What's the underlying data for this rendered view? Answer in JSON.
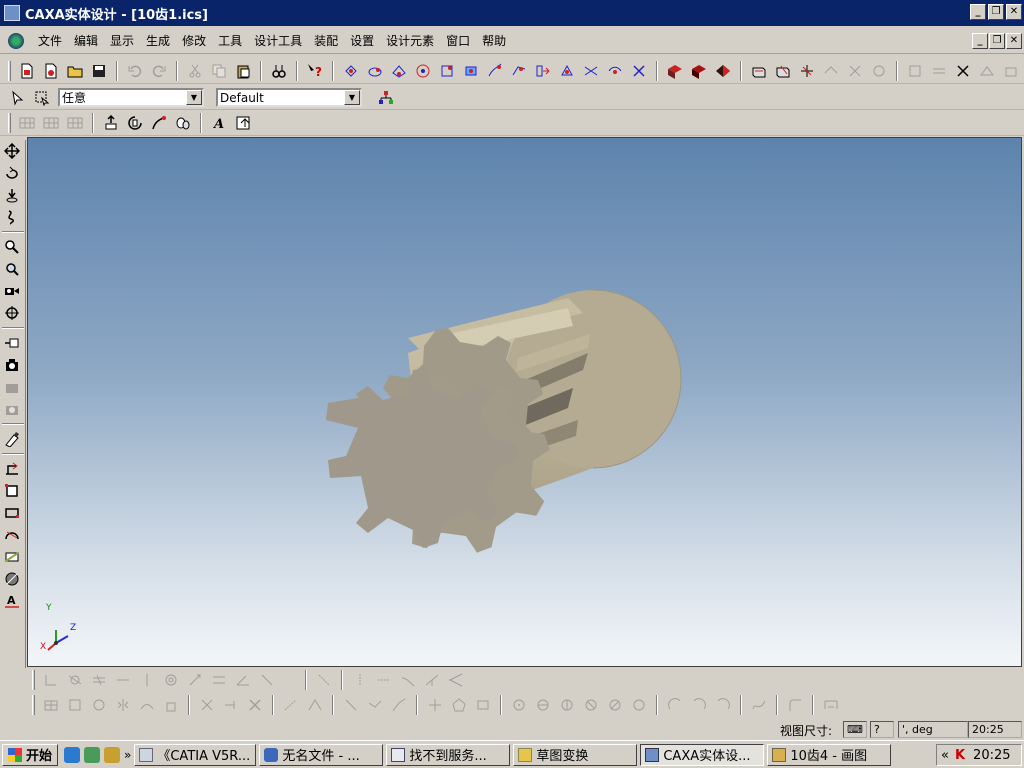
{
  "window": {
    "title": "CAXA实体设计 - [10齿1.ics]",
    "minimize_label": "_",
    "restore_label": "❐",
    "close_label": "✕"
  },
  "menu": {
    "items": [
      "文件",
      "编辑",
      "显示",
      "生成",
      "修改",
      "工具",
      "设计工具",
      "装配",
      "设置",
      "设计元素",
      "窗口",
      "帮助"
    ]
  },
  "toolbar2": {
    "filter_value": "任意",
    "style_value": "Default"
  },
  "viewport": {
    "triad": {
      "y_label": "Y",
      "x_label": "X",
      "z_label": "Z"
    },
    "colors": {
      "gear": "#a29a89",
      "body": "#bdb399",
      "bg_top": "#5d83ad",
      "bg_bottom": "#f3f6f9"
    }
  },
  "status": {
    "view_size_label": "视图尺寸:",
    "units": "', deg",
    "clock_small": "20:25"
  },
  "taskbar": {
    "start_label": "开始",
    "chevron": "»",
    "tasks": [
      {
        "label": "《CATIA V5R..."
      },
      {
        "label": "无名文件 - ..."
      },
      {
        "label": "找不到服务..."
      },
      {
        "label": "草图变换"
      },
      {
        "label": "CAXA实体设..."
      },
      {
        "label": "10齿4 - 画图"
      }
    ],
    "tray_chevron": "«",
    "clock": "20:25"
  }
}
